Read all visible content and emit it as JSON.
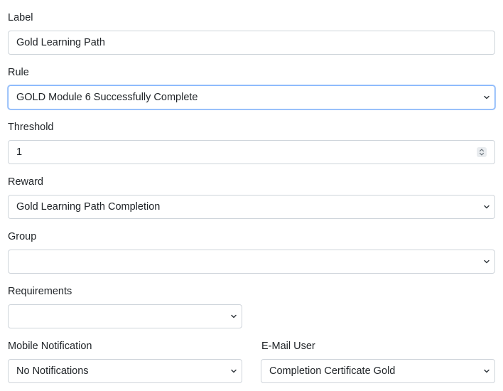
{
  "form": {
    "label": {
      "title": "Label",
      "value": "Gold Learning Path"
    },
    "rule": {
      "title": "Rule",
      "value": "GOLD Module 6 Successfully Complete"
    },
    "threshold": {
      "title": "Threshold",
      "value": "1"
    },
    "reward": {
      "title": "Reward",
      "value": "Gold Learning Path Completion"
    },
    "group": {
      "title": "Group",
      "value": ""
    },
    "requirements": {
      "title": "Requirements",
      "value": ""
    },
    "mobile_notification": {
      "title": "Mobile Notification",
      "value": "No Notifications"
    },
    "email_user": {
      "title": "E-Mail User",
      "value": "Completion Certificate Gold"
    }
  },
  "colors": {
    "border": "#ced4da",
    "focus_border": "#86b7fe",
    "text": "#212529"
  },
  "icons": {
    "select_arrow": "chevron-down-icon",
    "number_spinner": "spinner-icon"
  }
}
